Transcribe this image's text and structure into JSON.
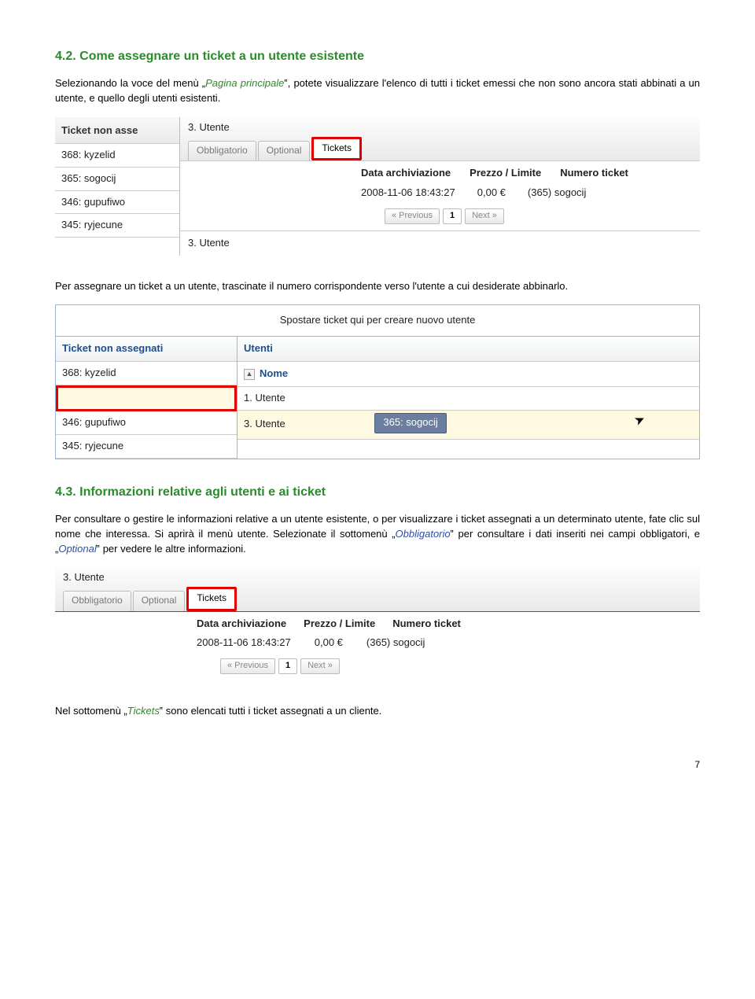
{
  "sec42": {
    "heading": "4.2.  Come assegnare un ticket a un utente esistente",
    "p1_a": "Selezionando la voce del menù „",
    "p1_link": "Pagina principale",
    "p1_b": "‟, potete visualizzare l'elenco di tutti i ticket emessi che non sono ancora stati abbinati a un utente, e quello degli utenti esistenti.",
    "p2": "Per assegnare un ticket a un utente, trascinate il numero corrispondente verso l'utente a cui desiderate abbinarlo."
  },
  "shot1": {
    "user_header": "3. Utente",
    "left_header": "Ticket non asse",
    "tabs": {
      "obbl": "Obbligatorio",
      "opt": "Optional",
      "tick": "Tickets"
    },
    "cols": {
      "data": "Data archiviazione",
      "prezzo": "Prezzo / Limite",
      "num": "Numero ticket"
    },
    "row": {
      "data": "2008-11-06 18:43:27",
      "prezzo": "0,00 €",
      "num": "(365) sogocij"
    },
    "pager": {
      "prev": "« Previous",
      "cur": "1",
      "next": "Next »"
    },
    "left_rows": [
      "368: kyzelid",
      "365: sogocij",
      "346: gupufiwo",
      "345: ryjecune"
    ],
    "right_user_row": "3. Utente"
  },
  "shot2": {
    "drop_hint": "Spostare ticket qui per creare nuovo utente",
    "left_header": "Ticket non assegnati",
    "right_header": "Utenti",
    "nome": "Nome",
    "left_rows": [
      "368: kyzelid",
      "",
      "346: gupufiwo",
      "345: ryjecune"
    ],
    "right_rows": [
      "1. Utente",
      "3. Utente"
    ],
    "drag_chip": "365: sogocij"
  },
  "sec43": {
    "heading": "4.3.  Informazioni relative agli utenti e ai ticket",
    "p1_a": "Per consultare o gestire le informazioni relative a un utente esistente, o per visualizzare i ticket assegnati a un determinato utente, fate clic sul nome che interessa. Si aprirà il menù utente. Selezionate il sottomenù „",
    "p1_b": "‟ per consultare i dati inseriti nei campi obbligatori, e „",
    "p1_c": "‟ per vedere le altre informazioni.",
    "obbl": "Obbligatorio",
    "opt": "Optional"
  },
  "shot3": {
    "user_header": "3. Utente",
    "tabs": {
      "obbl": "Obbligatorio",
      "opt": "Optional",
      "tick": "Tickets"
    },
    "cols": {
      "data": "Data archiviazione",
      "prezzo": "Prezzo / Limite",
      "num": "Numero ticket"
    },
    "row": {
      "data": "2008-11-06 18:43:27",
      "prezzo": "0,00 €",
      "num": "(365) sogocij"
    },
    "pager": {
      "prev": "« Previous",
      "cur": "1",
      "next": "Next »"
    }
  },
  "footer": {
    "p_a": "Nel sottomenù „",
    "p_link": "Tickets",
    "p_b": "‟ sono elencati tutti i ticket assegnati a un cliente.",
    "page": "7"
  }
}
